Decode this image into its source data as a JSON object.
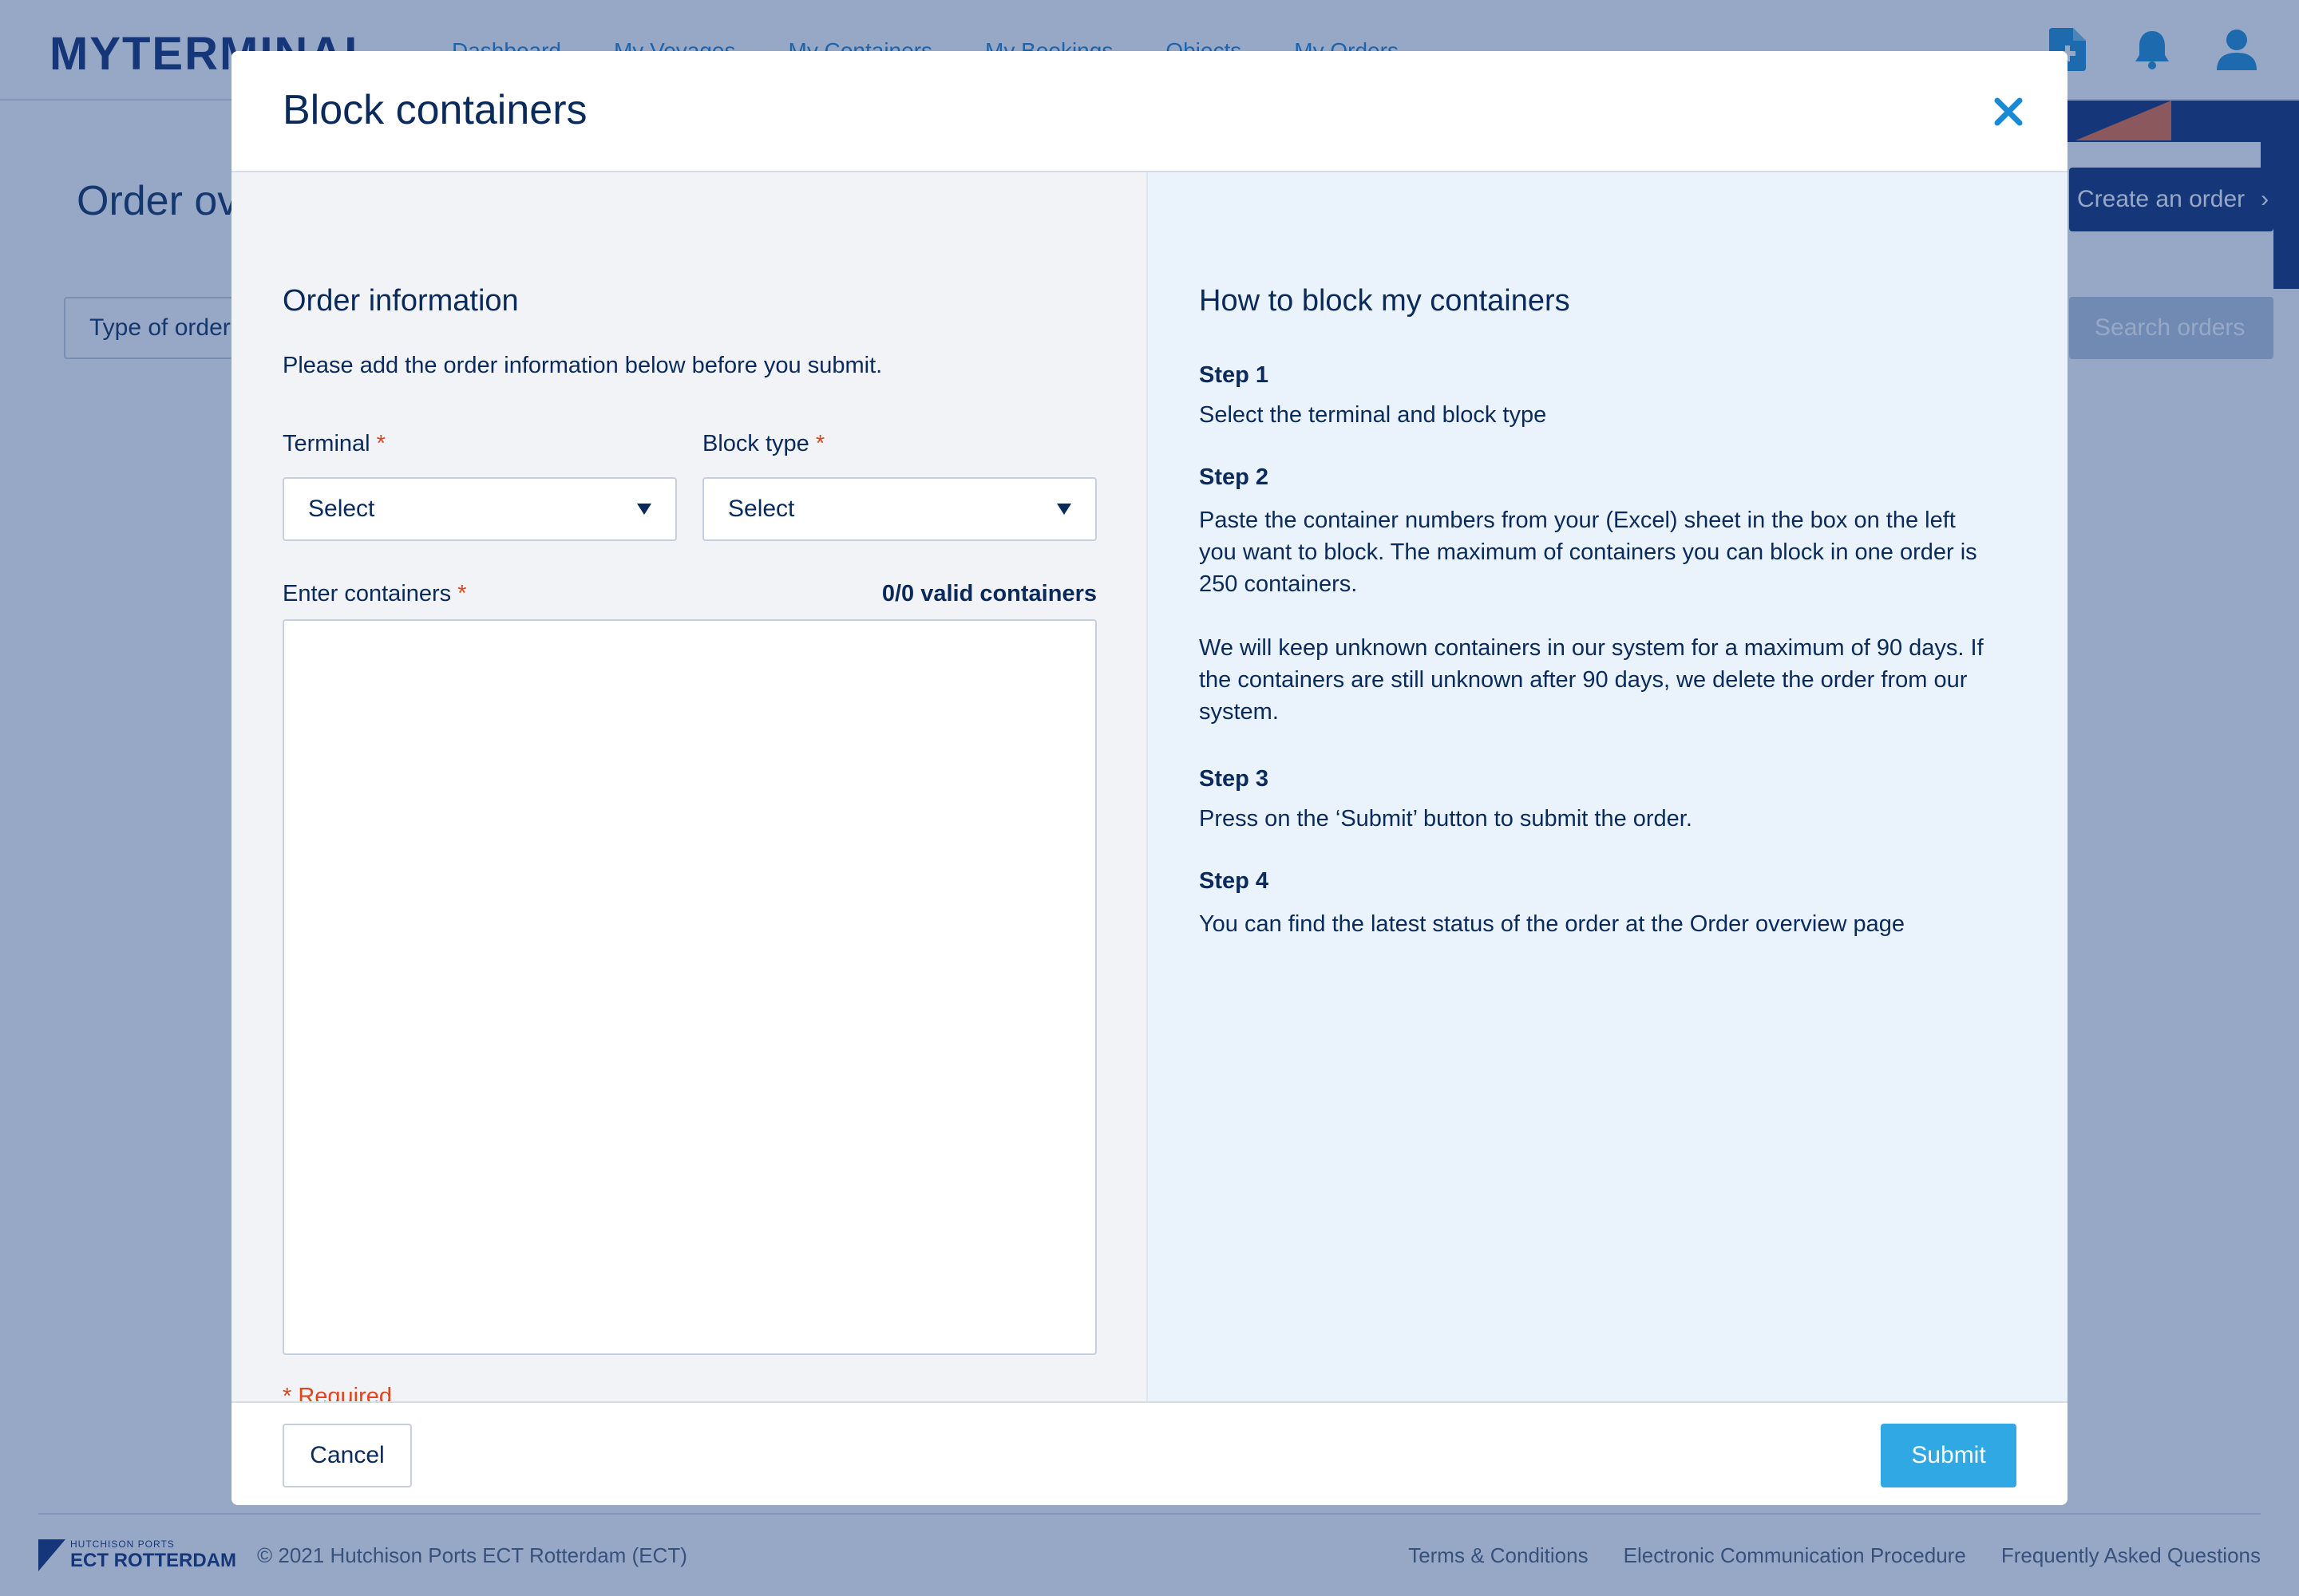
{
  "app": {
    "logo": "MYTERMINAL",
    "nav": [
      "Dashboard",
      "My Voyages",
      "My Containers",
      "My Bookings",
      "Objects",
      "My Orders"
    ],
    "icons": [
      "document-add-icon",
      "bell-icon",
      "user-icon"
    ]
  },
  "page": {
    "title": "Order overview",
    "create_button": "Create an order",
    "filter_placeholder": "Type of order",
    "search_button": "Search orders"
  },
  "footer": {
    "logo_small": "HUTCHISON PORTS",
    "logo_big": "ECT ROTTERDAM",
    "copyright": "© 2021 Hutchison Ports ECT Rotterdam (ECT)",
    "links": [
      "Terms & Conditions",
      "Electronic Communication Procedure",
      "Frequently Asked Questions"
    ]
  },
  "modal": {
    "title": "Block containers",
    "left": {
      "section_title": "Order information",
      "intro": "Please add the order information below before you submit.",
      "terminal_label": "Terminal",
      "terminal_value": "Select",
      "block_type_label": "Block type",
      "block_type_value": "Select",
      "containers_label": "Enter containers",
      "valid_count": "0/0 valid containers",
      "containers_value": "",
      "required_star": "*",
      "required_note": "* Required"
    },
    "right": {
      "section_title": "How to block my containers",
      "steps": [
        {
          "title": "Step 1",
          "text": "Select the terminal and block type"
        },
        {
          "title": "Step 2",
          "text": "Paste the container numbers from your (Excel) sheet in the box on the left you want to block. The maximum of containers you can block in one order is 250 containers."
        },
        {
          "title": "",
          "text": "We will keep unknown containers in our system for a maximum of 90 days. If the containers are still unknown after 90 days, we delete the order from our system."
        },
        {
          "title": "Step 3",
          "text": "Press on the ‘Submit’ button to submit the order."
        },
        {
          "title": "Step 4",
          "text": "You can find the latest status of the order at the Order overview page"
        }
      ]
    },
    "footer": {
      "cancel": "Cancel",
      "submit": "Submit"
    }
  },
  "colors": {
    "brand_navy": "#0a2a6e",
    "accent_blue": "#2fa8e4",
    "required_red": "#e0451f"
  }
}
